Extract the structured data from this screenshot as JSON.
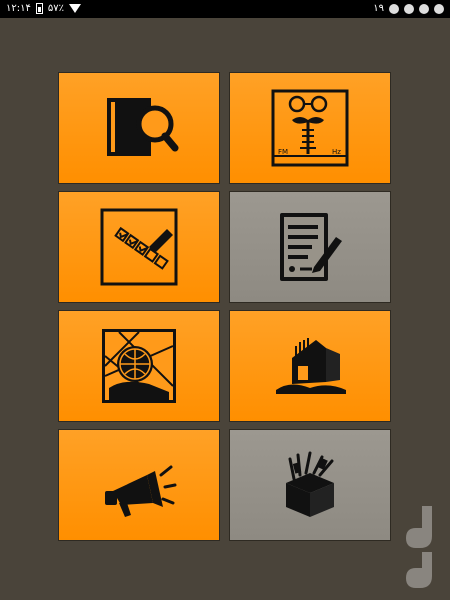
{
  "status_bar": {
    "time": "۱۲:۱۴",
    "battery": "۵۷٪",
    "notification_count": "۱۹"
  },
  "tiles": [
    {
      "name": "book-search",
      "color": "orange",
      "icon": "book-magnifier-icon"
    },
    {
      "name": "face-meter",
      "color": "orange",
      "icon": "mustache-face-gauge-icon",
      "labels": [
        "FM",
        "Hz"
      ]
    },
    {
      "name": "checklist",
      "color": "orange",
      "icon": "checklist-pen-icon"
    },
    {
      "name": "document-sign",
      "color": "gray",
      "icon": "document-pen-icon"
    },
    {
      "name": "globe-map",
      "color": "orange",
      "icon": "globe-map-icon"
    },
    {
      "name": "building",
      "color": "orange",
      "icon": "building-icon"
    },
    {
      "name": "announcement",
      "color": "orange",
      "icon": "megaphone-icon"
    },
    {
      "name": "toolbox",
      "color": "gray",
      "icon": "toolbox-icon"
    }
  ]
}
